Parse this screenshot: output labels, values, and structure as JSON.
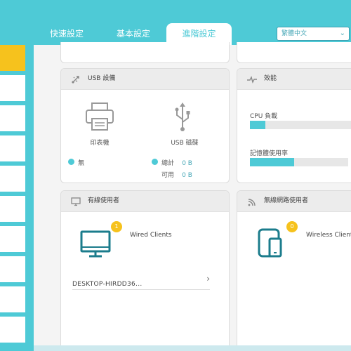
{
  "nav": {
    "tabs": [
      "快速設定",
      "基本設定",
      "進階設定"
    ],
    "active_tab": "進階設定",
    "language": "繁體中文"
  },
  "usb": {
    "title": "USB 設備",
    "printer_label": "印表機",
    "printer_status": "無",
    "disk_label": "USB 磁碟",
    "total_label": "總計",
    "total_value": "0 B",
    "available_label": "可用",
    "available_value": "0 B"
  },
  "performance": {
    "title": "效能",
    "cpu_label": "CPU 負載",
    "cpu_fraction": 0.14,
    "memory_label": "記憶體使用率",
    "memory_fraction": 0.45
  },
  "wired": {
    "title": "有線使用者",
    "label": "Wired Clients",
    "count": "1",
    "client_name": "DESKTOP-HIRDD36..."
  },
  "wireless": {
    "title": "無線網路使用者",
    "label": "Wireless Clients",
    "count": "0"
  },
  "colors": {
    "accent": "#4ecad6",
    "badge": "#f6c21d",
    "icon": "#1b7c8c"
  }
}
